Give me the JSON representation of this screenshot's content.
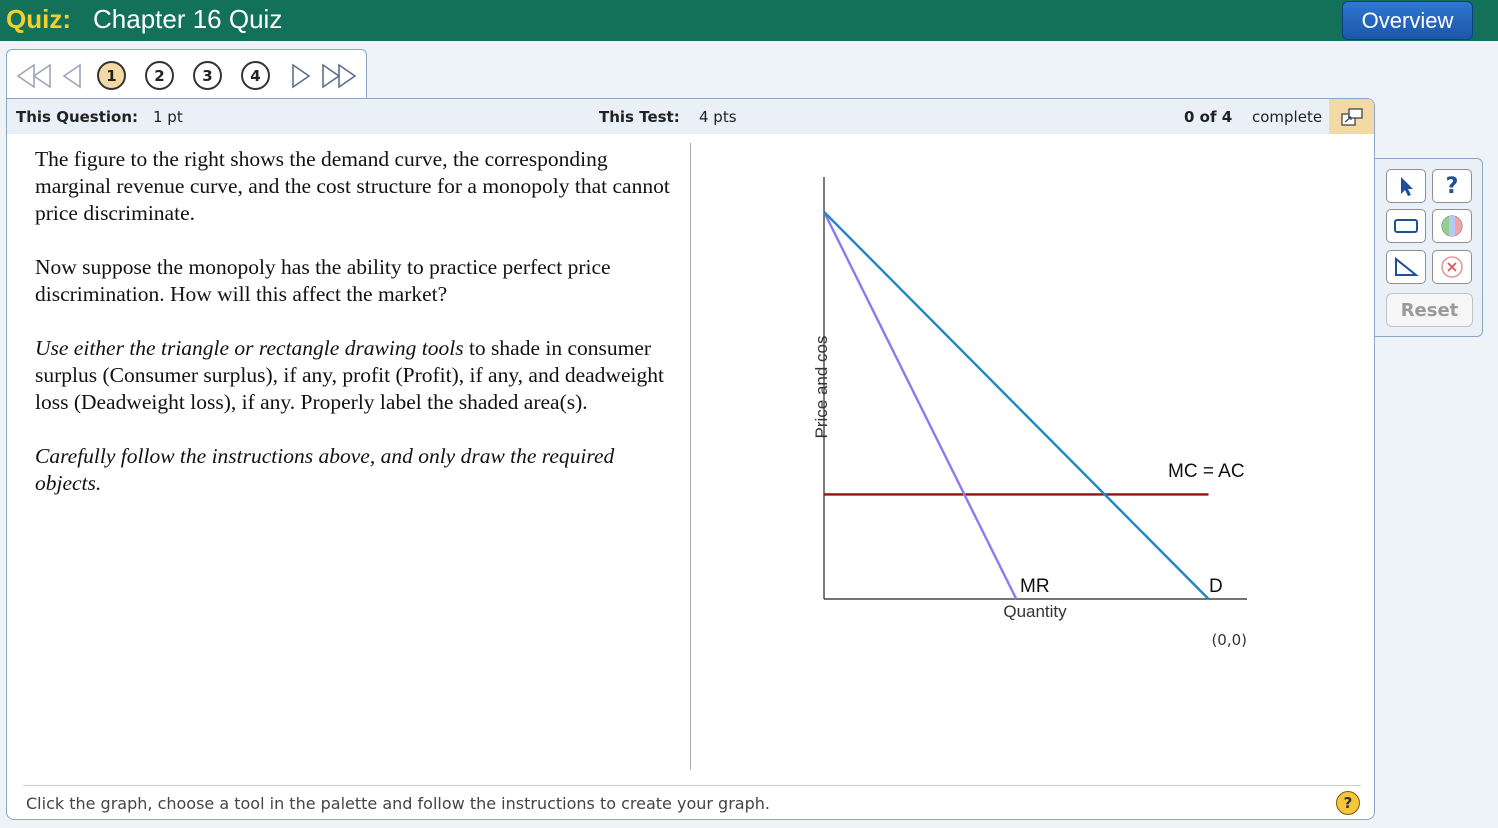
{
  "header": {
    "quiz_label": "Quiz:",
    "quiz_title": "Chapter 16 Quiz",
    "overview_label": "Overview"
  },
  "nav": {
    "questions": [
      "1",
      "2",
      "3",
      "4"
    ],
    "active": "1"
  },
  "info": {
    "question_label": "This Question:",
    "question_value": "1 pt",
    "test_label": "This Test:",
    "test_value": "4 pts",
    "progress_value": "0 of 4",
    "progress_label": "complete"
  },
  "question": {
    "p1": "The figure to the right shows the demand curve, the corresponding marginal revenue curve, and the cost structure for a monopoly that cannot price discriminate.",
    "p2": "Now suppose the monopoly has the ability to practice perfect price discrimination. How will this affect the market?",
    "p3_italic": "Use either the triangle or rectangle drawing tools",
    "p3_rest": " to shade in consumer surplus (Consumer surplus), if any, profit (Profit), if any, and deadweight loss (Deadweight loss), if any. Properly label the shaded area(s).",
    "p4": "Carefully follow the instructions above, and only draw the required objects."
  },
  "graph": {
    "ylabel": "Price and cos",
    "xlabel": "Quantity",
    "coords": "(0,0)",
    "mc_label": "MC = AC",
    "mr_label": "MR",
    "d_label": "D",
    "colors": {
      "demand": "#1f86c6",
      "mr": "#8a7cf0",
      "mc": "#8b1414",
      "axis": "#222222"
    }
  },
  "chart_data": {
    "type": "line",
    "series": [
      {
        "name": "D",
        "x": [
          0,
          1
        ],
        "y": [
          1,
          0
        ]
      },
      {
        "name": "MR",
        "x": [
          0,
          0.5
        ],
        "y": [
          1,
          0
        ]
      },
      {
        "name": "MC = AC",
        "x": [
          0,
          1
        ],
        "y": [
          0.27,
          0.27
        ]
      }
    ],
    "xlabel": "Quantity",
    "ylabel": "Price and cos",
    "xlim": [
      0,
      1.1
    ],
    "ylim": [
      0,
      1.09
    ]
  },
  "status": {
    "text": "Click the graph, choose a tool in the palette and follow the instructions to create your graph.",
    "help": "?"
  },
  "palette": {
    "reset_label": "Reset",
    "help_symbol": "?"
  }
}
